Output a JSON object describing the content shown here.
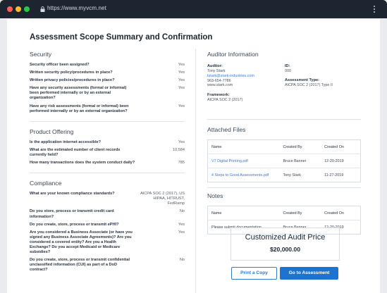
{
  "browser": {
    "url": "https://www.myvcm.net"
  },
  "page_title": "Assessment Scope Summary and Confirmation",
  "security": {
    "heading": "Security",
    "items": [
      {
        "q": "Security officer been assigned?",
        "a": "Yes"
      },
      {
        "q": "Written security policy/procedures in place?",
        "a": "Yes"
      },
      {
        "q": "Written privacy policies/procedures in place?",
        "a": "Yes"
      },
      {
        "q": "Have any security assessments (formal or informal) been performed internally or by an external organization?",
        "a": "Yes"
      },
      {
        "q": "Have any risk assessments (formal or informal) been performed internally or by an external organization?",
        "a": "Yes"
      }
    ]
  },
  "product_offering": {
    "heading": "Product Offering",
    "items": [
      {
        "q": "Is the application internet accessible?",
        "a": "Yes"
      },
      {
        "q": "What are the estimated number of client records currently held?",
        "a": "10,584"
      },
      {
        "q": "How many transactions does the system conduct daily?",
        "a": "785"
      }
    ]
  },
  "compliance": {
    "heading": "Compliance",
    "items": [
      {
        "q": "What are your known compliance standards?",
        "a": "AICPA SOC 2 (2017), US HIPAA, HITRUST, FedRamp"
      },
      {
        "q": "Do you store, process or transmit credit card information?",
        "a": "No"
      },
      {
        "q": "Do you create, store, process or transmit ePHI?",
        "a": "Yes"
      },
      {
        "q": "Are you considered a Business Associate (or have you signed any Business Associate Agreements)? Are you considered a covered entity? Are you a Health Exchange? Do you accept Medicaid or Medicare subsidies?",
        "a": "Yes"
      },
      {
        "q": "Do you create, store, process or transmit confidential unclassified information (CUI) as part of a DoD contract?",
        "a": "No"
      }
    ]
  },
  "auditor": {
    "heading": "Auditor Information",
    "auditor_label": "Auditor:",
    "name": "Tony Stark",
    "email": "tstark@stark-industries.com",
    "phone": "963-654-7786",
    "website": "www.stark.com",
    "id_label": "ID:",
    "id": "000",
    "assessment_type_label": "Assessment Type:",
    "assessment_type": "AICPA SOC 2 (2017) Type II",
    "framework_label": "Framework:",
    "framework": "AICPA SOC 2 (2017)"
  },
  "attached_files": {
    "heading": "Attached Files",
    "columns": [
      "Name",
      "Created By",
      "Created On"
    ],
    "rows": [
      [
        "V7 Digital Printing.pdf",
        "Bruce Banner",
        "12-20-2019"
      ],
      [
        "4 Steps to Good Assessments.pdf",
        "Tony Stark",
        "11-27-2019"
      ]
    ]
  },
  "notes": {
    "heading": "Notes",
    "columns": [
      "Name",
      "Created By",
      "Created On"
    ],
    "rows": [
      [
        "Please submit documentation",
        "Bruce Banner",
        "12-20-2019"
      ]
    ]
  },
  "price": {
    "title": "Customized Audit Price",
    "value": "$20,000.00"
  },
  "actions": {
    "print": "Print a Copy",
    "go": "Go to Assessment"
  },
  "colors": {
    "primary": "#1d74d0",
    "link": "#3b7bd4",
    "titlebar": "#1d2530"
  }
}
